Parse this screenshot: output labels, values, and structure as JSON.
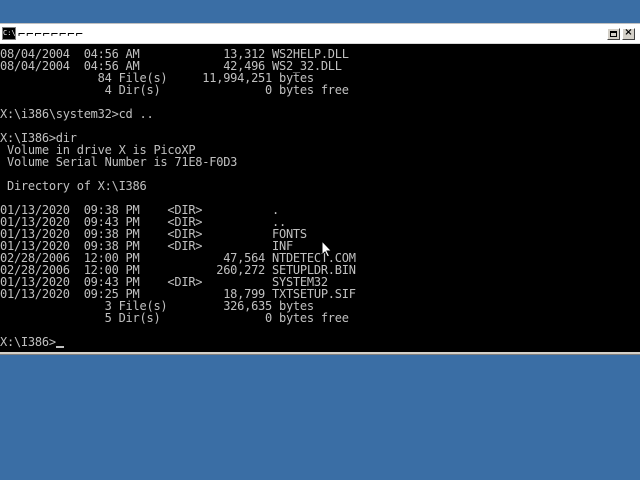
{
  "window": {
    "title": "⌐⌐⌐⌐⌐⌐⌐⌐",
    "icon": "console-icon"
  },
  "console": {
    "lines": [
      "08/04/2004  04:56 AM            13,312 WS2HELP.DLL",
      "08/04/2004  04:56 AM            42,496 WS2_32.DLL",
      "              84 File(s)     11,994,251 bytes",
      "               4 Dir(s)               0 bytes free",
      "",
      "X:\\i386\\system32>cd ..",
      "",
      "X:\\I386>dir",
      " Volume in drive X is PicoXP",
      " Volume Serial Number is 71E8-F0D3",
      "",
      " Directory of X:\\I386",
      "",
      "01/13/2020  09:38 PM    <DIR>          .",
      "01/13/2020  09:43 PM    <DIR>          ..",
      "01/13/2020  09:38 PM    <DIR>          FONTS",
      "01/13/2020  09:38 PM    <DIR>          INF",
      "02/28/2006  12:00 PM            47,564 NTDETECT.COM",
      "02/28/2006  12:00 PM           260,272 SETUPLDR.BIN",
      "01/13/2020  09:43 PM    <DIR>          SYSTEM32",
      "01/13/2020  09:25 PM            18,799 TXTSETUP.SIF",
      "               3 File(s)        326,635 bytes",
      "               5 Dir(s)               0 bytes free",
      "",
      "X:\\I386>"
    ]
  },
  "colors": {
    "desktop": "#3a6ea5",
    "console_bg": "#000000",
    "console_fg": "#c0c0c0"
  }
}
